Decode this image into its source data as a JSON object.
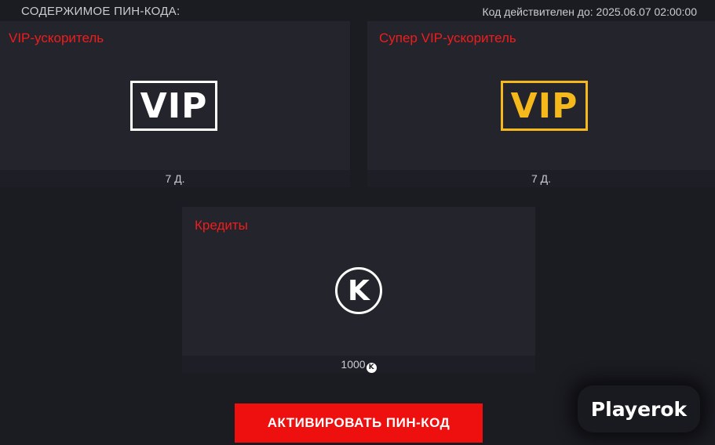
{
  "header": {
    "title": "СОДЕРЖИМОЕ ПИН-КОДА:",
    "expiry": "Код действителен до: 2025.06.07 02:00:00"
  },
  "cards": [
    {
      "title": "VIP-ускоритель",
      "badge_text": "VIP",
      "badge_color": "#ffffff",
      "duration": "7 Д."
    },
    {
      "title": "Супер VIP-ускоритель",
      "badge_text": "VIP",
      "badge_color": "#f6b91b",
      "duration": "7 Д."
    },
    {
      "title": "Кредиты",
      "badge_text": "K",
      "amount": "1000",
      "currency_icon": "credits-icon"
    }
  ],
  "actions": {
    "activate_label": "АКТИВИРОВАТЬ ПИН-КОД"
  },
  "watermark": {
    "text": "Playerok"
  },
  "colors": {
    "accent": "#ee0f0f",
    "title_red": "#f01d1d",
    "super_vip": "#f6b91b",
    "background": "#1b1c22",
    "card": "#23242c"
  }
}
